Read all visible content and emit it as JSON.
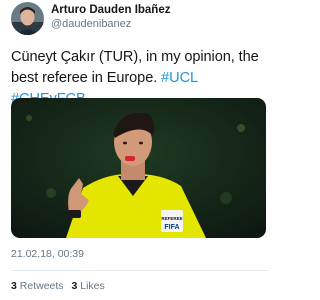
{
  "user": {
    "display_name": "Arturo Dauden Ibañez",
    "handle": "@daudenibanez",
    "avatar_icon": "profile-photo"
  },
  "tweet": {
    "text_part1": "Cüneyt Çakır (TUR), in my opinion, the best referee in Europe. ",
    "hashtags": [
      "#UCL",
      "#CHEvFCB"
    ],
    "timestamp": "21.02.18, 00:39"
  },
  "media": {
    "description_icon": "referee-photo",
    "badge_line1": "REFEREE",
    "badge_line2": "FIFA"
  },
  "stats": {
    "retweets_count": "3",
    "retweets_label": "Retweets",
    "likes_count": "3",
    "likes_label": "Likes"
  },
  "colors": {
    "link": "#1b95e0",
    "secondary_text": "#657786",
    "divider": "#e6ecf0",
    "referee_shirt": "#e4e600"
  }
}
